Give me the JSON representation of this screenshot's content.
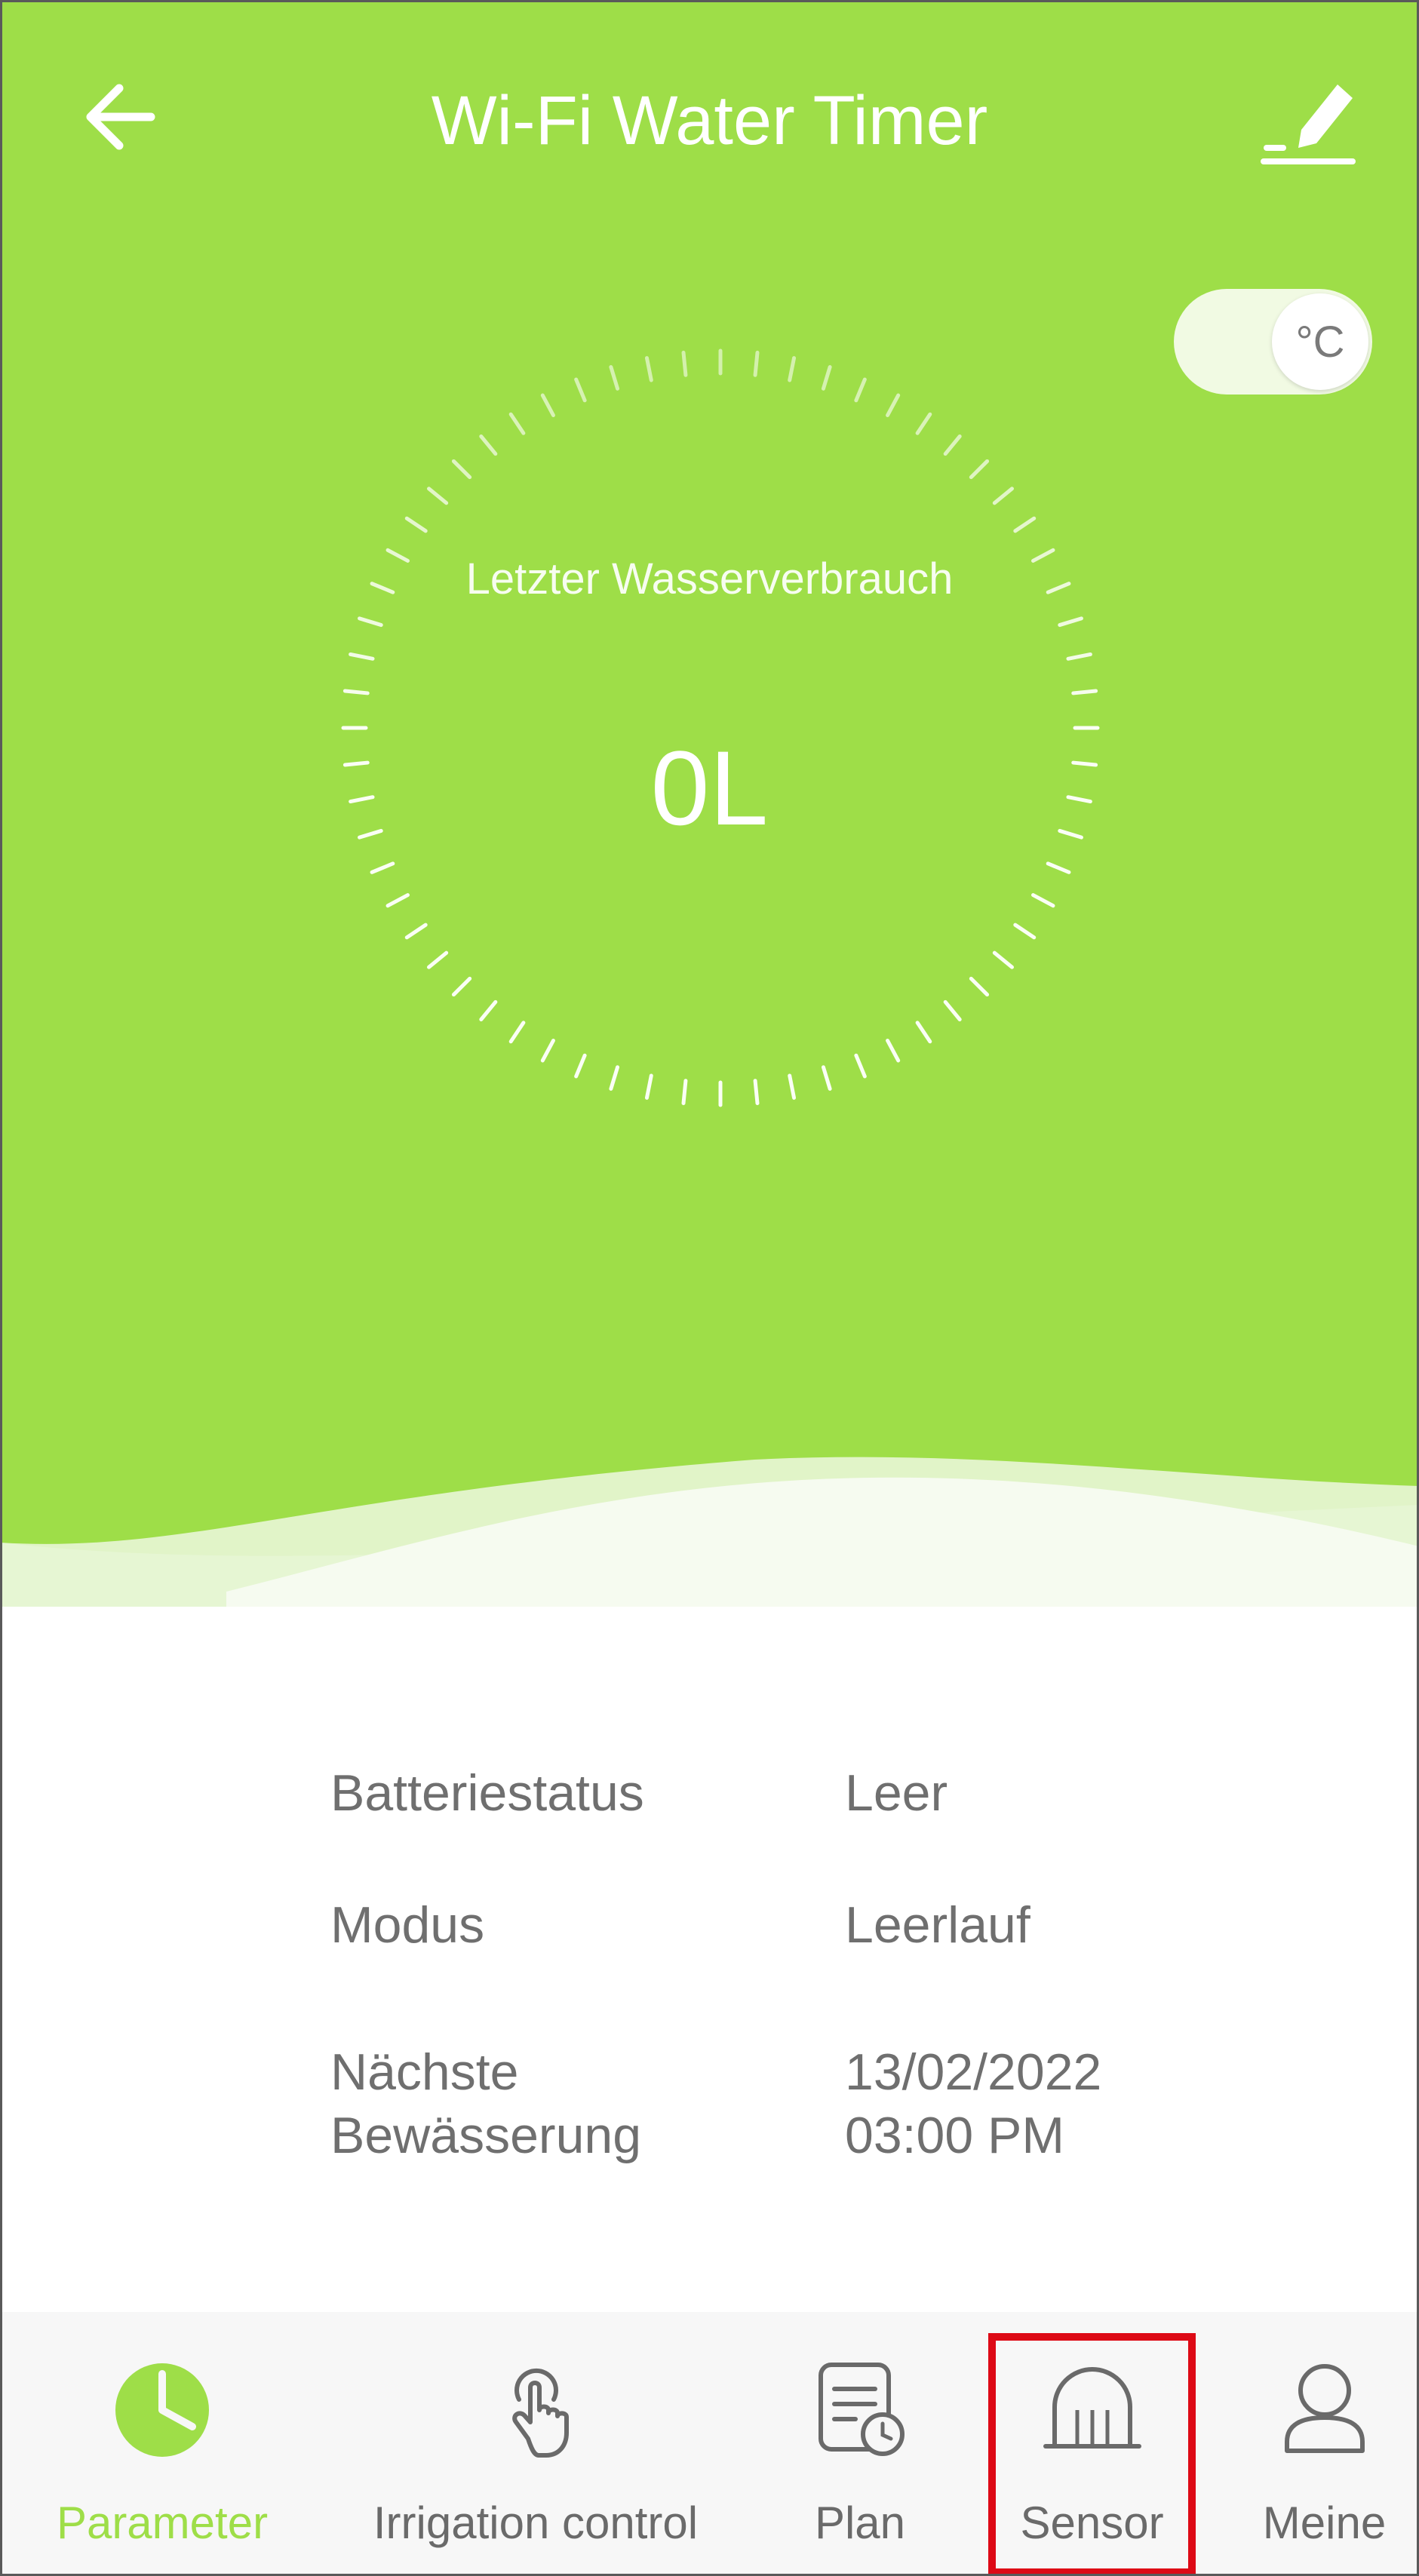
{
  "colors": {
    "accent": "#9ede48",
    "highlight": "#dd0a16",
    "text_muted": "#6f6f6f"
  },
  "header": {
    "title": "Wi-Fi Water Timer",
    "back_icon": "arrow-left-icon",
    "edit_icon": "pencil-icon"
  },
  "unit_toggle": {
    "label": "°C",
    "state": "off"
  },
  "gauge": {
    "label": "Letzter Wasserverbrauch",
    "value": "0L"
  },
  "info": [
    {
      "label": "Batteriestatus",
      "value": "Leer"
    },
    {
      "label": "Modus",
      "value": "Leerlauf"
    },
    {
      "label_lines": [
        "Nächste",
        "Bewässerung"
      ],
      "value_lines": [
        "13/02/2022",
        "03:00 PM"
      ]
    }
  ],
  "tabs": [
    {
      "label": "Parameter",
      "icon": "pie-chart-icon",
      "active": true
    },
    {
      "label": "Irrigation control",
      "icon": "touch-hand-icon",
      "active": false
    },
    {
      "label": "Plan",
      "icon": "schedule-document-icon",
      "active": false
    },
    {
      "label": "Sensor",
      "icon": "sensor-icon",
      "active": false,
      "highlighted": true
    },
    {
      "label": "Meine",
      "icon": "user-icon",
      "active": false
    }
  ]
}
